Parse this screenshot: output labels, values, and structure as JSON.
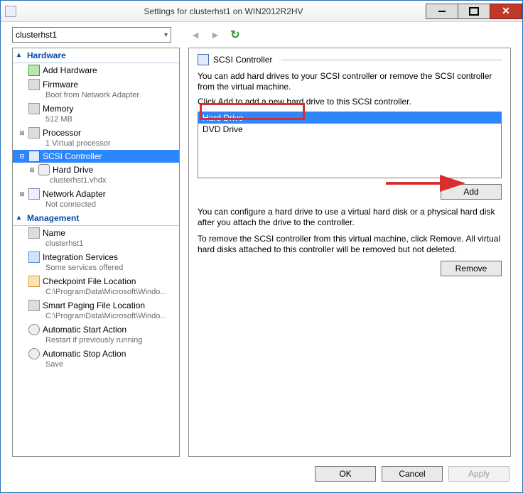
{
  "window": {
    "title": "Settings for clusterhst1 on WIN2012R2HV"
  },
  "toolbar": {
    "vm_selected": "clusterhst1"
  },
  "sections": {
    "hardware": "Hardware",
    "management": "Management"
  },
  "hw": {
    "add_hardware": "Add Hardware",
    "firmware": "Firmware",
    "firmware_sub": "Boot from Network Adapter",
    "memory": "Memory",
    "memory_sub": "512 MB",
    "processor": "Processor",
    "processor_sub": "1 Virtual processor",
    "scsi": "SCSI Controller",
    "hard_drive": "Hard Drive",
    "hard_drive_sub": "clusterhst1.vhdx",
    "net": "Network Adapter",
    "net_sub": "Not connected"
  },
  "mg": {
    "name": "Name",
    "name_sub": "clusterhst1",
    "integ": "Integration Services",
    "integ_sub": "Some services offered",
    "chk": "Checkpoint File Location",
    "chk_sub": "C:\\ProgramData\\Microsoft\\Windo...",
    "smart": "Smart Paging File Location",
    "smart_sub": "C:\\ProgramData\\Microsoft\\Windo...",
    "autostart": "Automatic Start Action",
    "autostart_sub": "Restart if previously running",
    "autostop": "Automatic Stop Action",
    "autostop_sub": "Save"
  },
  "pane": {
    "title": "SCSI Controller",
    "desc1": "You can add hard drives to your SCSI controller or remove the SCSI controller from the virtual machine.",
    "desc2": "Click Add to add a new hard drive to this SCSI controller.",
    "options": {
      "hard_drive": "Hard Drive",
      "dvd_drive": "DVD Drive"
    },
    "add": "Add",
    "desc3": "You can configure a hard drive to use a virtual hard disk or a physical hard disk after you attach the drive to the controller.",
    "desc4": "To remove the SCSI controller from this virtual machine, click Remove. All virtual hard disks attached to this controller will be removed but not deleted.",
    "remove": "Remove"
  },
  "buttons": {
    "ok": "OK",
    "cancel": "Cancel",
    "apply": "Apply"
  }
}
